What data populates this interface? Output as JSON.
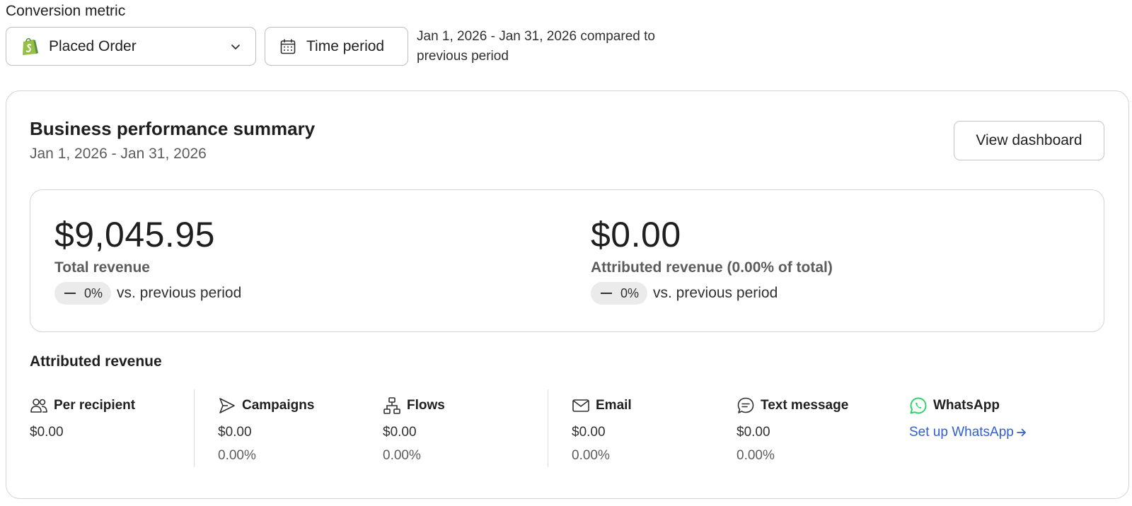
{
  "conversion_metric": {
    "label": "Conversion metric",
    "selected": "Placed Order",
    "source_icon": "shopify-icon",
    "time_button_label": "Time period",
    "period_text": "Jan 1, 2026 - Jan 31, 2026 compared to previous period"
  },
  "summary": {
    "title": "Business performance summary",
    "date_range": "Jan 1, 2026 - Jan 31, 2026",
    "view_button": "View dashboard",
    "total_revenue": {
      "amount": "$9,045.95",
      "label": "Total revenue",
      "change": "0%",
      "comparison": "vs. previous period"
    },
    "attributed_revenue": {
      "amount": "$0.00",
      "label": "Attributed revenue (0.00% of total)",
      "change": "0%",
      "comparison": "vs. previous period"
    }
  },
  "attributed": {
    "title": "Attributed revenue",
    "metrics": [
      {
        "icon": "people-icon",
        "label": "Per recipient",
        "value": "$0.00"
      },
      {
        "icon": "send-icon",
        "label": "Campaigns",
        "value": "$0.00",
        "percent": "0.00%"
      },
      {
        "icon": "flow-icon",
        "label": "Flows",
        "value": "$0.00",
        "percent": "0.00%"
      },
      {
        "icon": "mail-icon",
        "label": "Email",
        "value": "$0.00",
        "percent": "0.00%"
      },
      {
        "icon": "chat-icon",
        "label": "Text message",
        "value": "$0.00",
        "percent": "0.00%"
      },
      {
        "icon": "whatsapp-icon",
        "label": "WhatsApp",
        "link": "Set up WhatsApp"
      }
    ]
  },
  "colors": {
    "link": "#2f5fd0",
    "shopify_green": "#95bf47",
    "whatsapp_green": "#25d366",
    "pill_bg": "#ebebeb"
  }
}
